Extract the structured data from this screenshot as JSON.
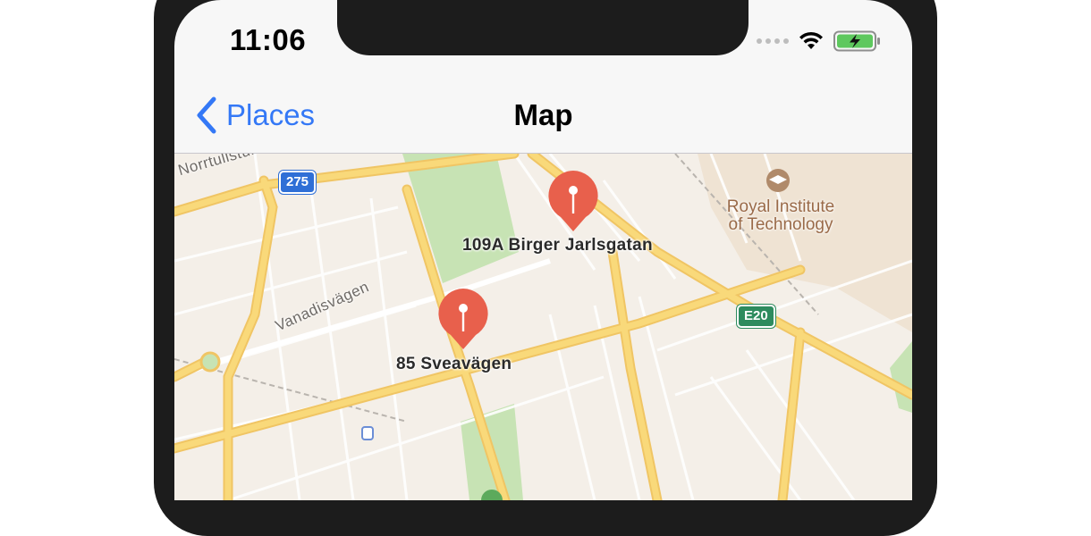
{
  "status_bar": {
    "time": "11:06"
  },
  "nav_bar": {
    "back_label": "Places",
    "title": "Map"
  },
  "map": {
    "streets": [
      "Norrtullstunn",
      "Vanadisvägen"
    ],
    "shields": [
      "275",
      "E20"
    ],
    "poi": {
      "line1": "Royal Institute",
      "line2": "of Technology"
    },
    "pins": [
      {
        "label": "109A Birger Jarlsgatan"
      },
      {
        "label": "85 Sveavägen"
      }
    ],
    "colors": {
      "pin": "#e8604c",
      "park": "#c7e3b4",
      "road": "#f9d97a",
      "campus": "#efe3d3"
    }
  }
}
